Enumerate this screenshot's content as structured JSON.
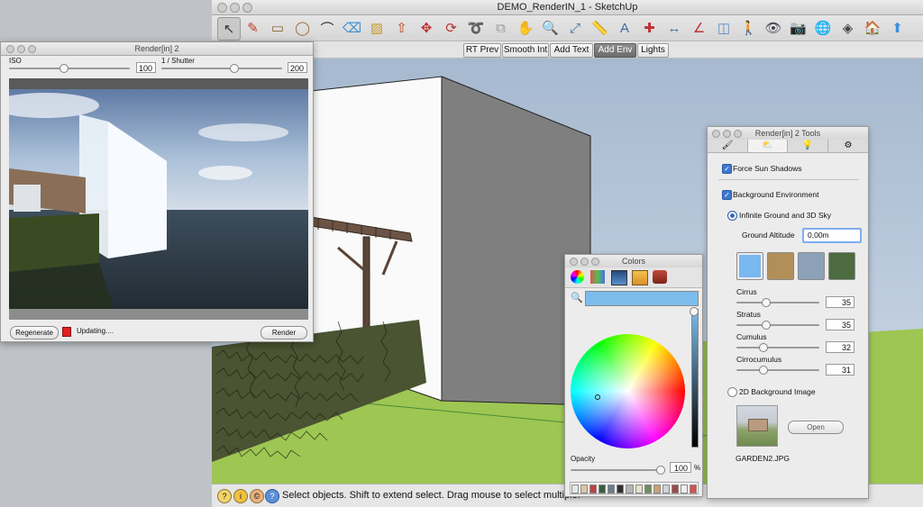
{
  "sketchup": {
    "title": "DEMO_RenderIN_1 - SketchUp",
    "toolbar_icons": [
      "select-icon",
      "pencil-icon",
      "rectangle-icon",
      "circle-icon",
      "arc-icon",
      "eraser-icon",
      "paint-bucket-icon",
      "push-pull-icon",
      "move-icon",
      "rotate-icon",
      "follow-me-icon",
      "offset-icon",
      "pan-icon",
      "zoom-icon",
      "zoom-extents-icon",
      "tape-measure-icon",
      "text-icon",
      "axes-icon",
      "dimensions-icon",
      "protractor-icon",
      "section-plane-icon",
      "walk-icon",
      "look-around-icon",
      "position-camera-icon",
      "orbit-icon",
      "components-icon",
      "warehouse-icon",
      "share-icon"
    ],
    "plugin_buttons": [
      {
        "label": "RT Prev",
        "active": false
      },
      {
        "label": "Smooth Int",
        "active": false
      },
      {
        "label": "Add Text",
        "active": false
      },
      {
        "label": "Add Env",
        "active": true
      },
      {
        "label": "Lights",
        "active": false
      }
    ],
    "status_text": "Select objects. Shift to extend select. Drag mouse to select multiple."
  },
  "render_window": {
    "title": "Render[in] 2",
    "iso_label": "ISO",
    "iso_value": "100",
    "iso_level": 0.45,
    "shutter_label": "1 / Shutter",
    "shutter_value": "200",
    "shutter_level": 0.6,
    "regenerate_label": "Regenerate",
    "status_label": "Updating....",
    "render_label": "Render"
  },
  "colors_panel": {
    "title": "Colors",
    "current_color": "#7cbcec",
    "opacity_label": "Opacity",
    "opacity_value": "100",
    "opacity_unit": "%",
    "swatches": [
      "#e7e7e7",
      "#d9c6a4",
      "#c04040",
      "#3b5d3b",
      "#6e7b8f",
      "#303030",
      "#b5b5b5",
      "#e5e0c8",
      "#6b8e5a",
      "#caa076",
      "#d2d2d2",
      "#a04848",
      "#efefef",
      "#d95050"
    ]
  },
  "tools_panel": {
    "title": "Render[in] 2 Tools",
    "tab_icons": [
      "paint-icon",
      "sun-cloud-icon",
      "bulb-icon",
      "settings-gear-icon"
    ],
    "force_sun_shadows": "Force Sun Shadows",
    "background_environment": "Background Environment",
    "infinite_ground": "Infinite Ground and 3D Sky",
    "ground_altitude_label": "Ground Altitude",
    "ground_altitude_value": "0,00m",
    "sky_presets": [
      "#7ab8f0",
      "#b08f58",
      "#8da2b8",
      "#4c6b3e"
    ],
    "clouds": [
      {
        "label": "Cirrus",
        "value": "35",
        "level": 0.35
      },
      {
        "label": "Stratus",
        "value": "35",
        "level": 0.35
      },
      {
        "label": "Cumulus",
        "value": "32",
        "level": 0.32
      },
      {
        "label": "Cirrocumulus",
        "value": "31",
        "level": 0.31
      }
    ],
    "bg_image_label": "2D Background Image",
    "open_label": "Open",
    "image_name": "GARDEN2.JPG"
  }
}
